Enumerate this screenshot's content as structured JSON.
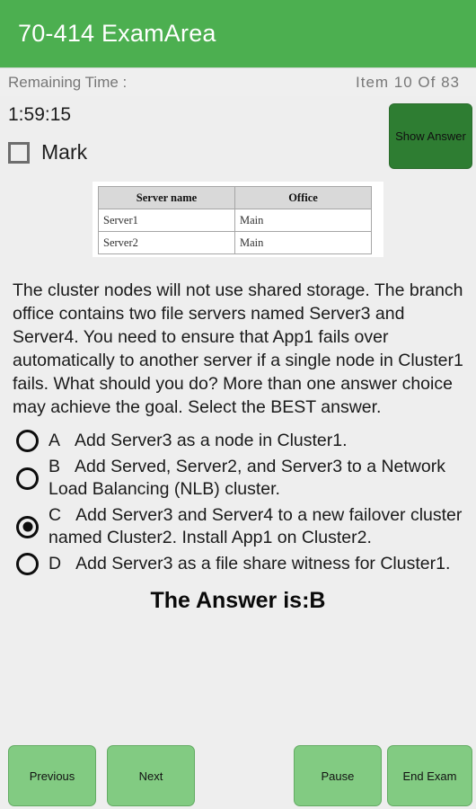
{
  "app": {
    "title": "70-414 ExamArea",
    "header_color": "#4caf50"
  },
  "status": {
    "remaining_time_label": "Remaining Time :",
    "item_counter": "Item 10 Of 83"
  },
  "meta": {
    "timer": "1:59:15",
    "mark_label": "Mark",
    "mark_checked": false,
    "show_answer_label": "Show Answer",
    "show_answer_color": "#2e7d32"
  },
  "exhibit": {
    "columns": [
      "Server name",
      "Office"
    ],
    "rows": [
      [
        "Server1",
        "Main"
      ],
      [
        "Server2",
        "Main"
      ]
    ]
  },
  "question": {
    "text": "The cluster nodes will not use shared storage. The branch office contains two file servers named Server3 and Server4. You need to ensure that App1 fails over automatically to another server if a single node in Cluster1 fails. What should you do? More than one answer choice may achieve the goal. Select the BEST answer."
  },
  "options": [
    {
      "letter": "A",
      "text": "Add Server3 as a node in Cluster1.",
      "selected": false
    },
    {
      "letter": "B",
      "text": "Add Served, Server2, and Server3 to a Network Load Balancing (NLB) cluster.",
      "selected": false
    },
    {
      "letter": "C",
      "text": "Add Server3 and Server4 to a new failover cluster named Cluster2. Install App1 on Cluster2.",
      "selected": true
    },
    {
      "letter": "D",
      "text": "Add Server3 as a file share witness for Cluster1.",
      "selected": false
    }
  ],
  "answer": {
    "text": "The Answer is:B"
  },
  "bottom_bar": {
    "previous_label": "Previous",
    "next_label": "Next",
    "pause_label": "Pause",
    "end_exam_label": "End Exam",
    "button_color": "#82cb82"
  }
}
